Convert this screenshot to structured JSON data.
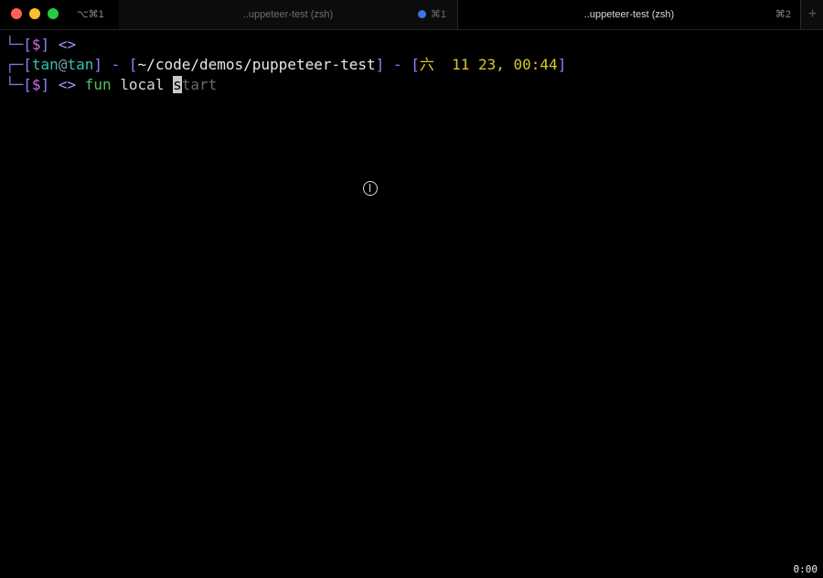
{
  "window": {
    "shortcut_left": "⌥⌘1",
    "tabs": [
      {
        "title": "..uppeteer-test (zsh)",
        "shortcut": "⌘1",
        "has_dot": true
      },
      {
        "title": "..uppeteer-test (zsh)",
        "shortcut": "⌘2"
      }
    ],
    "new_tab_label": "+"
  },
  "terminal": {
    "line1": {
      "box": "└─",
      "bracket_open": "[",
      "dollar": "$",
      "bracket_close": "]",
      "arrow": "<>"
    },
    "line2": {
      "box": "┌─",
      "user": "tan",
      "at": "@",
      "host": "tan",
      "sep": " - ",
      "path": "~/code/demos/puppeteer-test",
      "date": "六  11 23, 00:44"
    },
    "line3": {
      "box": "└─",
      "dollar": "$",
      "arrow": "<>",
      "cmd": "fun",
      "arg": "local",
      "cursor_char": "s",
      "suggestion": "tart"
    }
  },
  "recording_timer": "0:00",
  "colors": {
    "background": "#000000",
    "prompt_box": "#7a7ad8",
    "dollar": "#d070e8",
    "user": "#36c1b0",
    "date": "#d8c62a",
    "command": "#4cc25d",
    "suggestion": "#6a6a6a",
    "tab_dot": "#3b74e6"
  }
}
